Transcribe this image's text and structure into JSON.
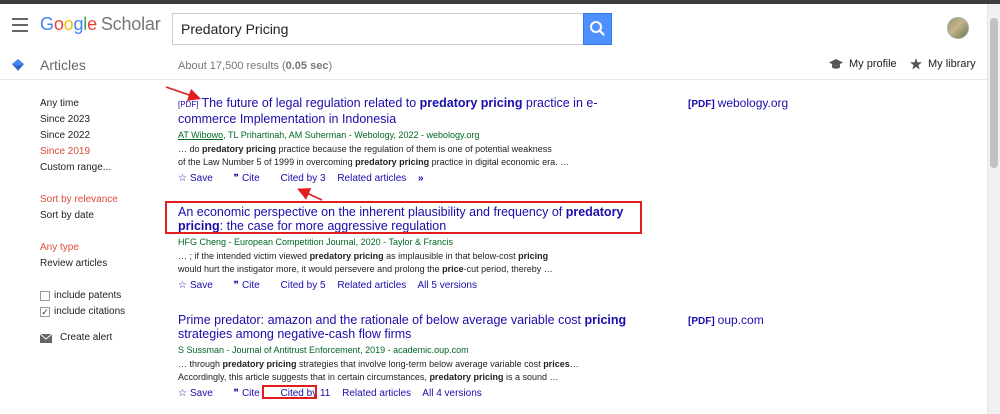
{
  "header": {
    "logo_letters": [
      "G",
      "o",
      "o",
      "g",
      "l",
      "e"
    ],
    "logo_scholar": "Scholar",
    "search_value": "Predatory Pricing",
    "icons": {
      "menu": "hamburger-icon",
      "search": "search-icon",
      "avatar": "user-avatar"
    }
  },
  "subheader": {
    "section": "Articles",
    "results_prefix": "About 17,500 results (",
    "results_time": "0.05 sec",
    "results_suffix": ")",
    "my_profile": "My profile",
    "my_library": "My library"
  },
  "sidebar": {
    "time_filters": [
      "Any time",
      "Since 2023",
      "Since 2022",
      "Since 2019",
      "Custom range..."
    ],
    "active_time": "Since 2019",
    "sort": [
      "Sort by relevance",
      "Sort by date"
    ],
    "active_sort": "Sort by relevance",
    "type": [
      "Any type",
      "Review articles"
    ],
    "active_type": "Any type",
    "include_patents": "include patents",
    "include_citations": "include citations",
    "create_alert": "Create alert"
  },
  "results": [
    {
      "pdf_tag": "[PDF]",
      "title_parts": [
        {
          "t": "The future of legal regulation related to ",
          "b": false
        },
        {
          "t": "predatory pricing",
          "b": true
        },
        {
          "t": " practice in e-commerce Implementation in Indonesia",
          "b": false
        }
      ],
      "authors": "AT Wibowo",
      "meta": ", TL Prihartinah, AM Suherman - Webology, 2022 - webology.org",
      "snippet1": [
        {
          "t": "… do ",
          "b": false
        },
        {
          "t": "predatory pricing",
          "b": true
        },
        {
          "t": " practice because the regulation of them is one of potential weakness",
          "b": false
        }
      ],
      "snippet2": [
        {
          "t": "of the Law Number 5 of 1999 in overcoming ",
          "b": false
        },
        {
          "t": "predatory pricing",
          "b": true
        },
        {
          "t": " practice in digital economic era. …",
          "b": false
        }
      ],
      "links": {
        "save": "Save",
        "cite": "Cite",
        "cited_by": "Cited by 3",
        "related": "Related articles",
        "more": "»"
      },
      "side": {
        "tag": "[PDF]",
        "domain": "webology.org"
      }
    },
    {
      "title_parts": [
        {
          "t": "An economic perspective on the inherent plausibility and frequency of ",
          "b": false
        },
        {
          "t": "predatory pricing",
          "b": true
        },
        {
          "t": ": the case for more aggressive regulation",
          "b": false
        }
      ],
      "meta": "HFG Cheng - European Competition Journal, 2020 - Taylor & Francis",
      "snippet1": [
        {
          "t": "… ; if the intended victim viewed ",
          "b": false
        },
        {
          "t": "predatory pricing",
          "b": true
        },
        {
          "t": " as implausible in that below-cost ",
          "b": false
        },
        {
          "t": "pricing",
          "b": true
        }
      ],
      "snippet2": [
        {
          "t": "would hurt the instigator more, it would persevere and prolong the ",
          "b": false
        },
        {
          "t": "price",
          "b": true
        },
        {
          "t": "-cut period, thereby …",
          "b": false
        }
      ],
      "links": {
        "save": "Save",
        "cite": "Cite",
        "cited_by": "Cited by 5",
        "related": "Related articles",
        "versions": "All 5 versions"
      }
    },
    {
      "title_parts": [
        {
          "t": "Prime predator: amazon and the rationale of below average variable cost ",
          "b": false
        },
        {
          "t": "pricing",
          "b": true
        },
        {
          "t": " strategies among negative-cash flow firms",
          "b": false
        }
      ],
      "meta": "S Sussman - Journal of Antitrust Enforcement, 2019 - academic.oup.com",
      "snippet1": [
        {
          "t": "… through ",
          "b": false
        },
        {
          "t": "predatory pricing",
          "b": true
        },
        {
          "t": " strategies that involve long-term below average variable cost ",
          "b": false
        },
        {
          "t": "prices",
          "b": true
        },
        {
          "t": "…",
          "b": false
        }
      ],
      "snippet2": [
        {
          "t": "Accordingly, this article suggests that in certain circumstances, ",
          "b": false
        },
        {
          "t": "predatory pricing",
          "b": true
        },
        {
          "t": " is a sound …",
          "b": false
        }
      ],
      "links": {
        "save": "Save",
        "cite": "Cite",
        "cited_by": "Cited by 11",
        "related": "Related articles",
        "versions": "All 4 versions"
      },
      "side": {
        "tag": "[PDF]",
        "domain": "oup.com"
      }
    }
  ],
  "colors": {
    "link": "#1a0dab",
    "meta": "#006621",
    "active": "#dd4b39",
    "annotation": "#e01e1e",
    "search_button": "#4d90fe"
  }
}
